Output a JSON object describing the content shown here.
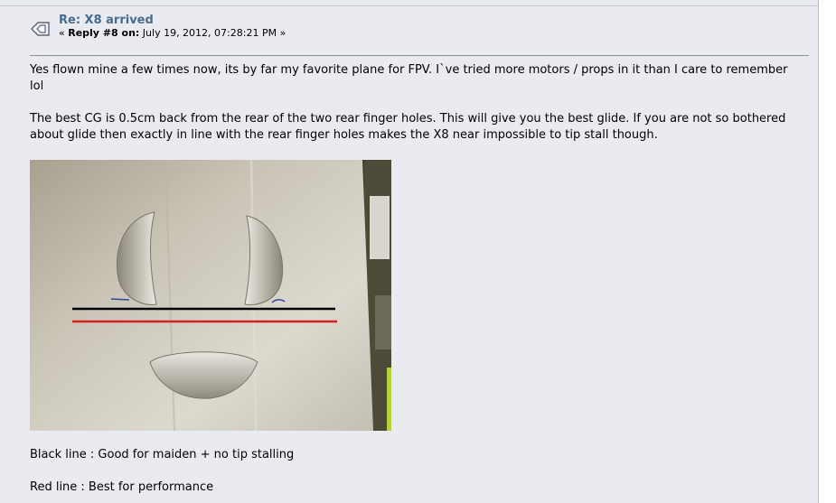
{
  "post": {
    "title": "Re: X8 arrived",
    "meta": {
      "prefix": "« ",
      "reply_label": "Reply #8 on:",
      "date": " July 19, 2012, 07:28:21 PM »"
    },
    "paragraphs": [
      "Yes flown mine a few times now, its by far my favorite plane for FPV. I`ve tried more motors / props in it than I care to remember lol",
      "The best CG is 0.5cm back from the rear of the two rear finger holes. This will give you the best glide. If you are not so bothered about glide then exactly in line with the rear finger holes makes the X8 near impossible to tip stall though."
    ],
    "captions": [
      "Black line : Good for maiden + no tip stalling",
      "Red  line : Best for performance"
    ]
  },
  "icons": {
    "post_icon": "post-topic-icon"
  },
  "colors": {
    "background": "#e9ebf0",
    "title": "#476c8e",
    "black_line": "#000000",
    "red_line": "#d42020"
  }
}
